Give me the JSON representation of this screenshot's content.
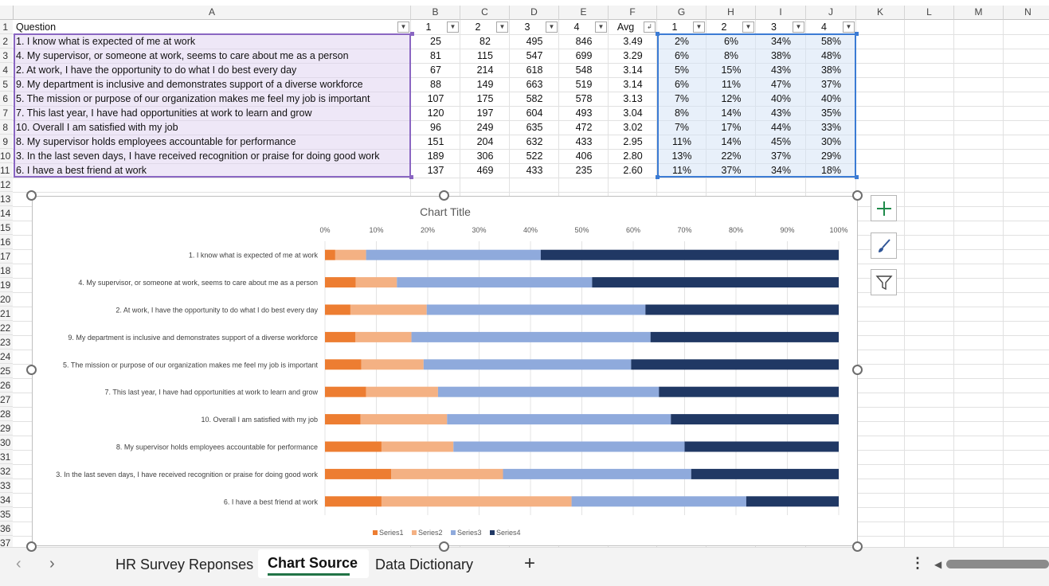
{
  "columns": [
    "A",
    "B",
    "C",
    "D",
    "E",
    "F",
    "G",
    "H",
    "I",
    "J",
    "K",
    "L",
    "M",
    "N"
  ],
  "row_numbers": [
    "1",
    "2",
    "3",
    "4",
    "5",
    "6",
    "7",
    "8",
    "9",
    "10",
    "11",
    "12",
    "13",
    "14",
    "15",
    "16",
    "17",
    "18",
    "19",
    "20",
    "21",
    "22",
    "23",
    "24",
    "25",
    "26",
    "27",
    "28",
    "29",
    "30",
    "31",
    "32",
    "33",
    "34",
    "35",
    "36",
    "37"
  ],
  "header_row": [
    "Question",
    "1",
    "2",
    "3",
    "4",
    "Avg",
    "1",
    "2",
    "3",
    "4"
  ],
  "table_rows": [
    [
      "1. I know what is expected of me at work",
      "25",
      "82",
      "495",
      "846",
      "3.49",
      "2%",
      "6%",
      "34%",
      "58%"
    ],
    [
      "4. My supervisor, or someone at work, seems to care about me as a person",
      "81",
      "115",
      "547",
      "699",
      "3.29",
      "6%",
      "8%",
      "38%",
      "48%"
    ],
    [
      "2. At work, I have the opportunity to do what I do best every day",
      "67",
      "214",
      "618",
      "548",
      "3.14",
      "5%",
      "15%",
      "43%",
      "38%"
    ],
    [
      "9. My department is inclusive and demonstrates support of a diverse workforce",
      "88",
      "149",
      "663",
      "519",
      "3.14",
      "6%",
      "11%",
      "47%",
      "37%"
    ],
    [
      "5. The mission or purpose of our organization makes me feel my job is important",
      "107",
      "175",
      "582",
      "578",
      "3.13",
      "7%",
      "12%",
      "40%",
      "40%"
    ],
    [
      "7. This last year, I have had opportunities at work to learn and grow",
      "120",
      "197",
      "604",
      "493",
      "3.04",
      "8%",
      "14%",
      "43%",
      "35%"
    ],
    [
      "10. Overall I am satisfied with my job",
      "96",
      "249",
      "635",
      "472",
      "3.02",
      "7%",
      "17%",
      "44%",
      "33%"
    ],
    [
      "8. My supervisor holds employees accountable for performance",
      "151",
      "204",
      "632",
      "433",
      "2.95",
      "11%",
      "14%",
      "45%",
      "30%"
    ],
    [
      "3. In the last seven days, I have received recognition or praise for doing good work",
      "189",
      "306",
      "522",
      "406",
      "2.80",
      "13%",
      "22%",
      "37%",
      "29%"
    ],
    [
      "6. I have a best friend at work",
      "137",
      "469",
      "433",
      "235",
      "2.60",
      "11%",
      "37%",
      "34%",
      "18%"
    ]
  ],
  "chart_data": {
    "type": "bar",
    "orientation": "horizontal",
    "stacked": "100%",
    "title": "Chart Title",
    "categories": [
      "1. I know what is expected of me at work",
      "4. My supervisor, or someone at work, seems to care about me as a person",
      "2. At work, I have the opportunity to do what I do best every day",
      "9. My department is inclusive and demonstrates support of a diverse workforce",
      "5. The mission or purpose of our organization makes me feel my job is important",
      "7. This last year, I have had opportunities at work to learn and grow",
      "10. Overall I am satisfied with my job",
      "8. My supervisor holds employees accountable for performance",
      "3. In the last seven days, I have received recognition or praise for doing good work",
      "6. I have a best friend at work"
    ],
    "series": [
      {
        "name": "Series1",
        "color": "#ed7d31",
        "values": [
          2,
          6,
          5,
          6,
          7,
          8,
          7,
          11,
          13,
          11
        ]
      },
      {
        "name": "Series2",
        "color": "#f4b183",
        "values": [
          6,
          8,
          15,
          11,
          12,
          14,
          17,
          14,
          22,
          37
        ]
      },
      {
        "name": "Series3",
        "color": "#8faadc",
        "values": [
          34,
          38,
          43,
          47,
          40,
          43,
          44,
          45,
          37,
          34
        ]
      },
      {
        "name": "Series4",
        "color": "#203864",
        "values": [
          58,
          48,
          38,
          37,
          40,
          35,
          33,
          30,
          29,
          18
        ]
      }
    ],
    "xlim": [
      0,
      100
    ],
    "x_ticks": [
      "0%",
      "10%",
      "20%",
      "30%",
      "40%",
      "50%",
      "60%",
      "70%",
      "80%",
      "90%",
      "100%"
    ],
    "xaxis_position": "top",
    "legend_position": "bottom",
    "grid": true
  },
  "chart_tools": {
    "add_element_icon": "plus-icon",
    "style_icon": "brush-icon",
    "filter_icon": "funnel-icon"
  },
  "tabs": [
    "HR Survey Reponses",
    "Chart Source",
    "Data Dictionary"
  ],
  "active_tab": "Chart Source",
  "colors": {
    "accent": "#217346",
    "selection_purple": "#8a66c2",
    "selection_blue": "#3b7bd4"
  }
}
